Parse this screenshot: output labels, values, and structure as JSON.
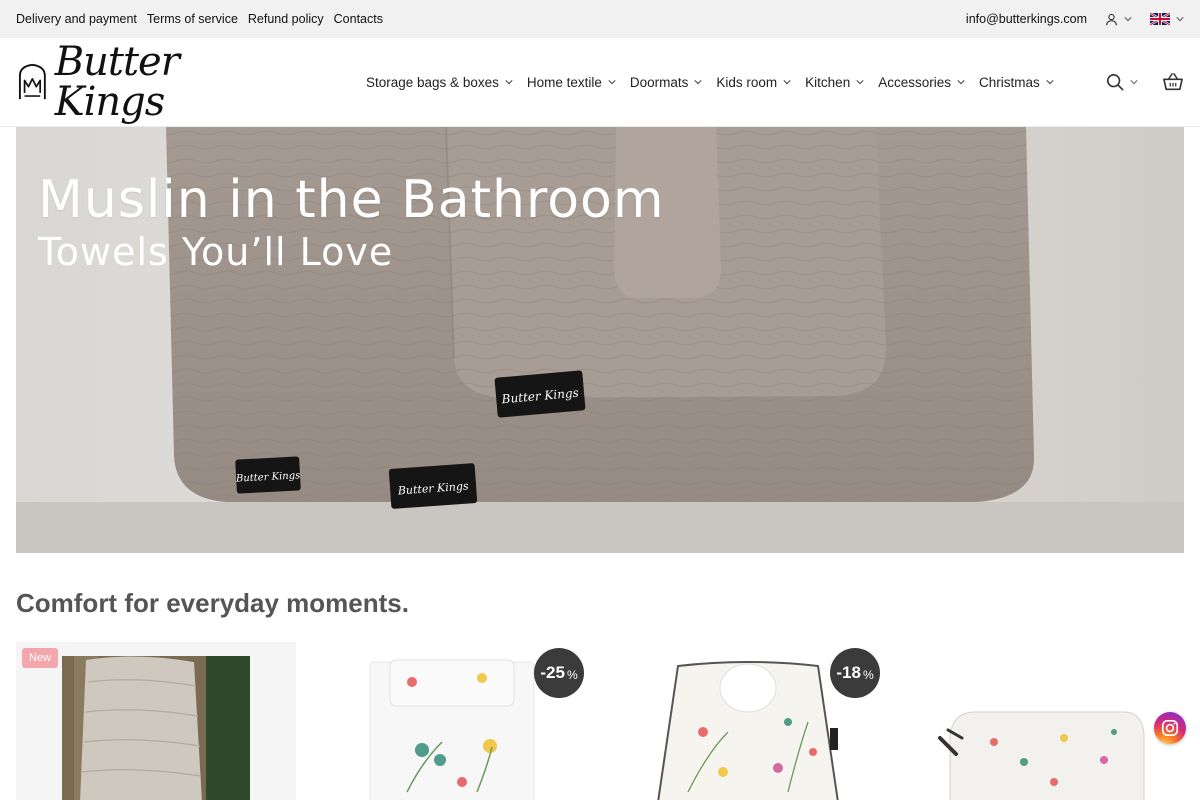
{
  "topbar": {
    "links": [
      "Delivery and payment",
      "Terms of service",
      "Refund policy",
      "Contacts"
    ],
    "email": "info@butterkings.com"
  },
  "header": {
    "logo_text": "Butter Kings",
    "nav": [
      "Storage bags & boxes",
      "Home textile",
      "Doormats",
      "Kids room",
      "Kitchen",
      "Accessories",
      "Christmas"
    ]
  },
  "hero": {
    "title": "Muslin in the Bathroom",
    "subtitle": "Towels You’ll Love",
    "tag_text": "Butter Kings"
  },
  "section": {
    "title": "Comfort for everyday moments."
  },
  "products": [
    {
      "badge": "New",
      "sale": ""
    },
    {
      "badge": "",
      "sale": "-25",
      "sale_unit": "%"
    },
    {
      "badge": "",
      "sale": "-18",
      "sale_unit": "%"
    },
    {
      "badge": "",
      "sale": ""
    }
  ],
  "colors": {
    "topbar_bg": "#f1f1f1",
    "sale_badge": "#3b3b3b",
    "new_badge": "#f3a6ac"
  },
  "icons": [
    "user-icon",
    "flag-uk-icon",
    "chevron-down-icon",
    "search-icon",
    "basket-icon",
    "instagram-icon"
  ]
}
